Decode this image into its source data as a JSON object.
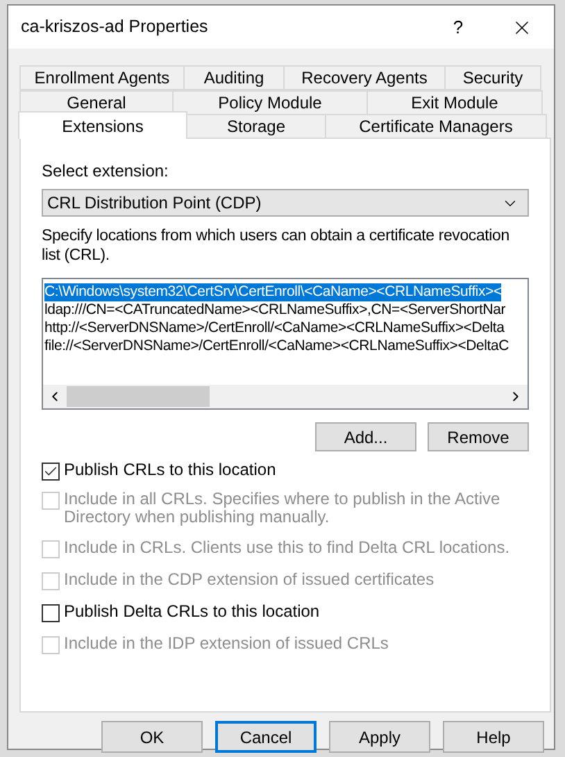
{
  "window": {
    "title": "ca-kriszos-ad Properties",
    "help_button": "?"
  },
  "tab_rows": [
    [
      {
        "label": "Enrollment Agents",
        "selected": false
      },
      {
        "label": "Auditing",
        "selected": false
      },
      {
        "label": "Recovery Agents",
        "selected": false
      },
      {
        "label": "Security",
        "selected": false
      }
    ],
    [
      {
        "label": "General",
        "selected": false
      },
      {
        "label": "Policy Module",
        "selected": false
      },
      {
        "label": "Exit Module",
        "selected": false
      }
    ],
    [
      {
        "label": "Extensions",
        "selected": true
      },
      {
        "label": "Storage",
        "selected": false
      },
      {
        "label": "Certificate Managers",
        "selected": false
      }
    ]
  ],
  "extension_select": {
    "label": "Select extension:",
    "value": "CRL Distribution Point (CDP)"
  },
  "locations": {
    "description": "Specify locations from which users can obtain a certificate revocation list (CRL).",
    "items": [
      {
        "text": "C:\\Windows\\system32\\CertSrv\\CertEnroll\\<CaName><CRLNameSuffix><",
        "selected": true
      },
      {
        "text": "ldap:///CN=<CATruncatedName><CRLNameSuffix>,CN=<ServerShortNar",
        "selected": false
      },
      {
        "text": "http://<ServerDNSName>/CertEnroll/<CaName><CRLNameSuffix><Delta",
        "selected": false
      },
      {
        "text": "file://<ServerDNSName>/CertEnroll/<CaName><CRLNameSuffix><DeltaC",
        "selected": false
      }
    ]
  },
  "location_buttons": [
    "Add...",
    "Remove"
  ],
  "options": [
    {
      "label": "Publish CRLs to this location",
      "checked": true,
      "disabled": false
    },
    {
      "label": "Include in all CRLs. Specifies where to publish in the Active Directory when publishing manually.",
      "checked": false,
      "disabled": true
    },
    {
      "label": "Include in CRLs. Clients use this to find Delta CRL locations.",
      "checked": false,
      "disabled": true
    },
    {
      "label": "Include in the CDP extension of issued certificates",
      "checked": false,
      "disabled": true
    },
    {
      "label": "Publish Delta CRLs to this location",
      "checked": false,
      "disabled": false
    },
    {
      "label": "Include in the IDP extension of issued CRLs",
      "checked": false,
      "disabled": true
    }
  ],
  "buttons": [
    {
      "label": "OK",
      "focused": false
    },
    {
      "label": "Cancel",
      "focused": true
    },
    {
      "label": "Apply",
      "focused": false
    },
    {
      "label": "Help",
      "focused": false
    }
  ]
}
